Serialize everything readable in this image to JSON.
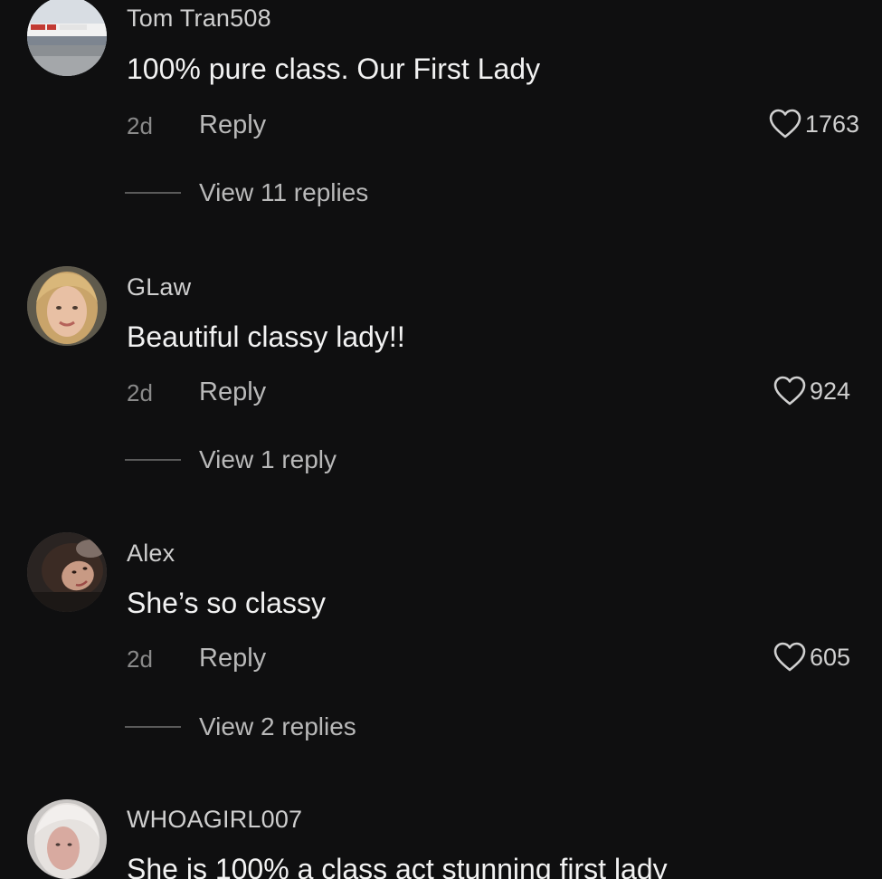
{
  "comments": [
    {
      "username": "Tom Tran508",
      "text": "100% pure class. Our First Lady",
      "time": "2d",
      "reply_label": "Reply",
      "likes": "1763",
      "view_replies": "View 11 replies",
      "avatar_icon": "storefront-photo-avatar"
    },
    {
      "username": "GLaw",
      "text": "Beautiful classy lady!!",
      "time": "2d",
      "reply_label": "Reply",
      "likes": "924",
      "view_replies": "View 1 reply",
      "avatar_icon": "blonde-woman-photo-avatar"
    },
    {
      "username": "Alex",
      "text": "She’s so classy",
      "time": "2d",
      "reply_label": "Reply",
      "likes": "605",
      "view_replies": "View 2 replies",
      "avatar_icon": "dark-hair-woman-photo-avatar"
    },
    {
      "username": "WHOAGIRL007",
      "text": "She is 100% a class act stunning first lady",
      "avatar_icon": "light-hair-woman-photo-avatar"
    }
  ],
  "colors": {
    "background": "#0f0f10",
    "username": "#cfcfcf",
    "body_text": "#f2f2f2",
    "muted": "#8a8a8a",
    "action": "#b9b9b9"
  }
}
